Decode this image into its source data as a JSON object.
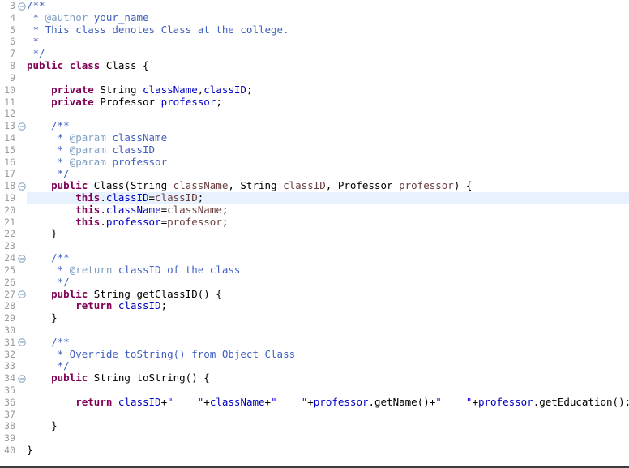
{
  "editor": {
    "language": "Java",
    "font_size_px": 12.5,
    "first_visible_line": 3,
    "last_visible_line": 40,
    "current_line": 19,
    "caret_line": 19,
    "caret_column": 22,
    "colors": {
      "background": "#ffffff",
      "gutter_background": "#ffffff",
      "line_number": "#9a9a9a",
      "current_line_highlight": "#e8f2fe",
      "keyword": "#7f0055",
      "javadoc": "#3f5fbf",
      "javadoc_tag": "#7f9fbf",
      "string": "#2a00ff",
      "field": "#0000c0",
      "parameter": "#6a3e3e",
      "plain_text": "#000000",
      "fold_marker": "#7f9dbf",
      "bottom_border": "#3c3c3c"
    },
    "fold_marker_icon": "collapse-minus-circle-icon"
  },
  "lines": [
    {
      "no": 3,
      "fold": "collapsed-marker",
      "tokens": [
        {
          "t": "/**",
          "c": "cmt"
        }
      ]
    },
    {
      "no": 4,
      "fold": null,
      "tokens": [
        {
          "t": " * ",
          "c": "cmt"
        },
        {
          "t": "@author",
          "c": "jdoc-tag"
        },
        {
          "t": " your_name",
          "c": "cmt"
        }
      ]
    },
    {
      "no": 5,
      "fold": null,
      "tokens": [
        {
          "t": " * This class denotes Class at the college.",
          "c": "cmt"
        }
      ]
    },
    {
      "no": 6,
      "fold": null,
      "tokens": [
        {
          "t": " *",
          "c": "cmt"
        }
      ]
    },
    {
      "no": 7,
      "fold": null,
      "tokens": [
        {
          "t": " */",
          "c": "cmt"
        }
      ]
    },
    {
      "no": 8,
      "fold": null,
      "tokens": [
        {
          "t": "public",
          "c": "kw"
        },
        {
          "t": " ",
          "c": "plain"
        },
        {
          "t": "class",
          "c": "kw"
        },
        {
          "t": " Class {",
          "c": "plain"
        }
      ]
    },
    {
      "no": 9,
      "fold": null,
      "tokens": []
    },
    {
      "no": 10,
      "fold": null,
      "tokens": [
        {
          "t": "    ",
          "c": "plain"
        },
        {
          "t": "private",
          "c": "kw"
        },
        {
          "t": " String ",
          "c": "plain"
        },
        {
          "t": "className",
          "c": "field"
        },
        {
          "t": ",",
          "c": "plain"
        },
        {
          "t": "classID",
          "c": "field"
        },
        {
          "t": ";",
          "c": "plain"
        }
      ]
    },
    {
      "no": 11,
      "fold": null,
      "tokens": [
        {
          "t": "    ",
          "c": "plain"
        },
        {
          "t": "private",
          "c": "kw"
        },
        {
          "t": " Professor ",
          "c": "plain"
        },
        {
          "t": "professor",
          "c": "field"
        },
        {
          "t": ";",
          "c": "plain"
        }
      ]
    },
    {
      "no": 12,
      "fold": null,
      "tokens": []
    },
    {
      "no": 13,
      "fold": "collapsed-marker",
      "tokens": [
        {
          "t": "    /**",
          "c": "cmt"
        }
      ]
    },
    {
      "no": 14,
      "fold": null,
      "tokens": [
        {
          "t": "     * ",
          "c": "cmt"
        },
        {
          "t": "@param",
          "c": "jdoc-tag"
        },
        {
          "t": " className",
          "c": "cmt"
        }
      ]
    },
    {
      "no": 15,
      "fold": null,
      "tokens": [
        {
          "t": "     * ",
          "c": "cmt"
        },
        {
          "t": "@param",
          "c": "jdoc-tag"
        },
        {
          "t": " classID",
          "c": "cmt"
        }
      ]
    },
    {
      "no": 16,
      "fold": null,
      "tokens": [
        {
          "t": "     * ",
          "c": "cmt"
        },
        {
          "t": "@param",
          "c": "jdoc-tag"
        },
        {
          "t": " professor",
          "c": "cmt"
        }
      ]
    },
    {
      "no": 17,
      "fold": null,
      "tokens": [
        {
          "t": "     */",
          "c": "cmt"
        }
      ]
    },
    {
      "no": 18,
      "fold": "collapsed-marker",
      "tokens": [
        {
          "t": "    ",
          "c": "plain"
        },
        {
          "t": "public",
          "c": "kw"
        },
        {
          "t": " Class(String ",
          "c": "plain"
        },
        {
          "t": "className",
          "c": "param"
        },
        {
          "t": ", String ",
          "c": "plain"
        },
        {
          "t": "classID",
          "c": "param"
        },
        {
          "t": ", Professor ",
          "c": "plain"
        },
        {
          "t": "professor",
          "c": "param"
        },
        {
          "t": ") {",
          "c": "plain"
        }
      ]
    },
    {
      "no": 19,
      "fold": null,
      "current": true,
      "caret_after": true,
      "tokens": [
        {
          "t": "        ",
          "c": "plain"
        },
        {
          "t": "this",
          "c": "kw"
        },
        {
          "t": ".",
          "c": "plain"
        },
        {
          "t": "classID",
          "c": "field"
        },
        {
          "t": "=",
          "c": "plain"
        },
        {
          "t": "classID",
          "c": "param"
        },
        {
          "t": ";",
          "c": "plain"
        }
      ]
    },
    {
      "no": 20,
      "fold": null,
      "tokens": [
        {
          "t": "        ",
          "c": "plain"
        },
        {
          "t": "this",
          "c": "kw"
        },
        {
          "t": ".",
          "c": "plain"
        },
        {
          "t": "className",
          "c": "field"
        },
        {
          "t": "=",
          "c": "plain"
        },
        {
          "t": "className",
          "c": "param"
        },
        {
          "t": ";",
          "c": "plain"
        }
      ]
    },
    {
      "no": 21,
      "fold": null,
      "tokens": [
        {
          "t": "        ",
          "c": "plain"
        },
        {
          "t": "this",
          "c": "kw"
        },
        {
          "t": ".",
          "c": "plain"
        },
        {
          "t": "professor",
          "c": "field"
        },
        {
          "t": "=",
          "c": "plain"
        },
        {
          "t": "professor",
          "c": "param"
        },
        {
          "t": ";",
          "c": "plain"
        }
      ]
    },
    {
      "no": 22,
      "fold": null,
      "tokens": [
        {
          "t": "    }",
          "c": "plain"
        }
      ]
    },
    {
      "no": 23,
      "fold": null,
      "tokens": []
    },
    {
      "no": 24,
      "fold": "collapsed-marker",
      "tokens": [
        {
          "t": "    /**",
          "c": "cmt"
        }
      ]
    },
    {
      "no": 25,
      "fold": null,
      "tokens": [
        {
          "t": "     * ",
          "c": "cmt"
        },
        {
          "t": "@return",
          "c": "jdoc-tag"
        },
        {
          "t": " classID of the class",
          "c": "cmt"
        }
      ]
    },
    {
      "no": 26,
      "fold": null,
      "tokens": [
        {
          "t": "     */",
          "c": "cmt"
        }
      ]
    },
    {
      "no": 27,
      "fold": "collapsed-marker",
      "tokens": [
        {
          "t": "    ",
          "c": "plain"
        },
        {
          "t": "public",
          "c": "kw"
        },
        {
          "t": " String getClassID() {",
          "c": "plain"
        }
      ]
    },
    {
      "no": 28,
      "fold": null,
      "tokens": [
        {
          "t": "        ",
          "c": "plain"
        },
        {
          "t": "return",
          "c": "kw"
        },
        {
          "t": " ",
          "c": "plain"
        },
        {
          "t": "classID",
          "c": "field"
        },
        {
          "t": ";",
          "c": "plain"
        }
      ]
    },
    {
      "no": 29,
      "fold": null,
      "tokens": [
        {
          "t": "    }",
          "c": "plain"
        }
      ]
    },
    {
      "no": 30,
      "fold": null,
      "tokens": []
    },
    {
      "no": 31,
      "fold": "collapsed-marker",
      "tokens": [
        {
          "t": "    /**",
          "c": "cmt"
        }
      ]
    },
    {
      "no": 32,
      "fold": null,
      "tokens": [
        {
          "t": "     * Override toString() from Object Class",
          "c": "cmt"
        }
      ]
    },
    {
      "no": 33,
      "fold": null,
      "tokens": [
        {
          "t": "     */",
          "c": "cmt"
        }
      ]
    },
    {
      "no": 34,
      "fold": "collapsed-marker",
      "tokens": [
        {
          "t": "    ",
          "c": "plain"
        },
        {
          "t": "public",
          "c": "kw"
        },
        {
          "t": " String toString() {",
          "c": "plain"
        }
      ]
    },
    {
      "no": 35,
      "fold": null,
      "tokens": []
    },
    {
      "no": 36,
      "fold": null,
      "tokens": [
        {
          "t": "        ",
          "c": "plain"
        },
        {
          "t": "return",
          "c": "kw"
        },
        {
          "t": " ",
          "c": "plain"
        },
        {
          "t": "classID",
          "c": "field"
        },
        {
          "t": "+",
          "c": "plain"
        },
        {
          "t": "\"    \"",
          "c": "str"
        },
        {
          "t": "+",
          "c": "plain"
        },
        {
          "t": "className",
          "c": "field"
        },
        {
          "t": "+",
          "c": "plain"
        },
        {
          "t": "\"    \"",
          "c": "str"
        },
        {
          "t": "+",
          "c": "plain"
        },
        {
          "t": "professor",
          "c": "field"
        },
        {
          "t": ".getName()+",
          "c": "plain"
        },
        {
          "t": "\"    \"",
          "c": "str"
        },
        {
          "t": "+",
          "c": "plain"
        },
        {
          "t": "professor",
          "c": "field"
        },
        {
          "t": ".getEducation();",
          "c": "plain"
        }
      ]
    },
    {
      "no": 37,
      "fold": null,
      "tokens": []
    },
    {
      "no": 38,
      "fold": null,
      "tokens": [
        {
          "t": "    }",
          "c": "plain"
        }
      ]
    },
    {
      "no": 39,
      "fold": null,
      "tokens": []
    },
    {
      "no": 40,
      "fold": null,
      "tokens": [
        {
          "t": "}",
          "c": "plain"
        }
      ]
    }
  ]
}
